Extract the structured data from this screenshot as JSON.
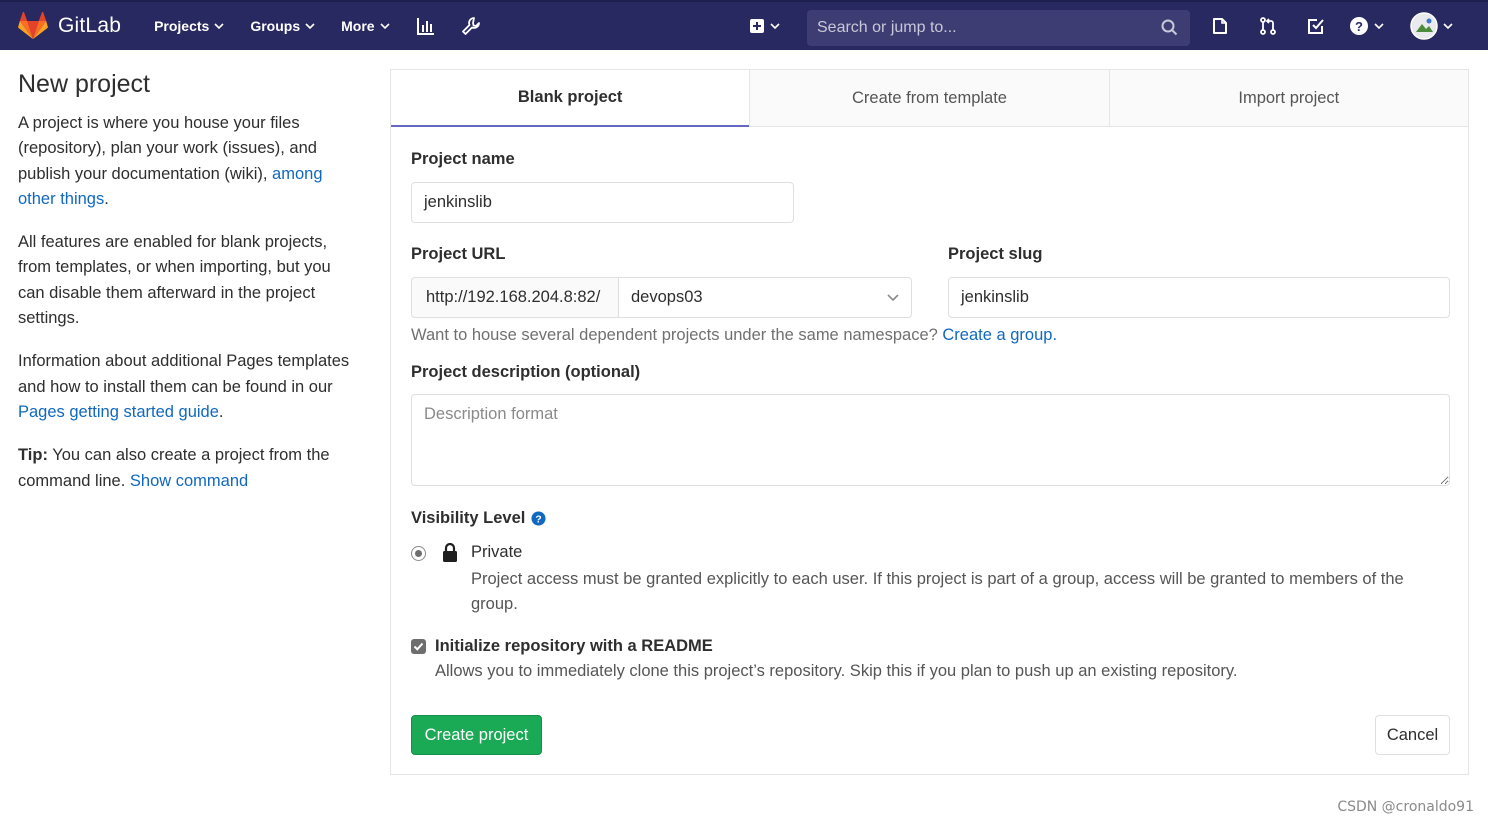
{
  "navbar": {
    "brand": "GitLab",
    "menu": [
      {
        "label": "Projects"
      },
      {
        "label": "Groups"
      },
      {
        "label": "More"
      }
    ],
    "search_placeholder": "Search or jump to..."
  },
  "intro": {
    "title": "New project",
    "p1_text": "A project is where you house your files (repository), plan your work (issues), and publish your documentation (wiki), ",
    "p1_link": "among other things",
    "p1_end": ".",
    "p2": "All features are enabled for blank projects, from templates, or when importing, but you can disable them afterward in the project settings.",
    "p3_text": "Information about additional Pages templates and how to install them can be found in our ",
    "p3_link": "Pages getting started guide",
    "p3_end": ".",
    "tip_label": "Tip:",
    "tip_text": " You can also create a project from the command line. ",
    "tip_link": "Show command"
  },
  "tabs": [
    {
      "label": "Blank project",
      "active": true
    },
    {
      "label": "Create from template",
      "active": false
    },
    {
      "label": "Import project",
      "active": false
    }
  ],
  "form": {
    "project_name_label": "Project name",
    "project_name_value": "jenkinslib",
    "project_url_label": "Project URL",
    "url_prefix": "http://192.168.204.8:82/",
    "namespace": "devops03",
    "project_slug_label": "Project slug",
    "project_slug_value": "jenkinslib",
    "namespace_hint": "Want to house several dependent projects under the same namespace? ",
    "namespace_hint_link": "Create a group.",
    "description_label": "Project description (optional)",
    "description_placeholder": "Description format",
    "visibility_label": "Visibility Level",
    "visibility_option": "Private",
    "visibility_desc": "Project access must be granted explicitly to each user. If this project is part of a group, access will be granted to members of the group.",
    "readme_label": "Initialize repository with a README",
    "readme_desc": "Allows you to immediately clone this project’s repository. Skip this if you plan to push up an existing repository.",
    "create_button": "Create project",
    "cancel_button": "Cancel"
  },
  "colors": {
    "navbar": "#292961",
    "link": "#1068bf",
    "primary_button": "#1aaa55",
    "active_tab_border": "#6666c4"
  },
  "watermark": "CSDN @cronaldo91"
}
